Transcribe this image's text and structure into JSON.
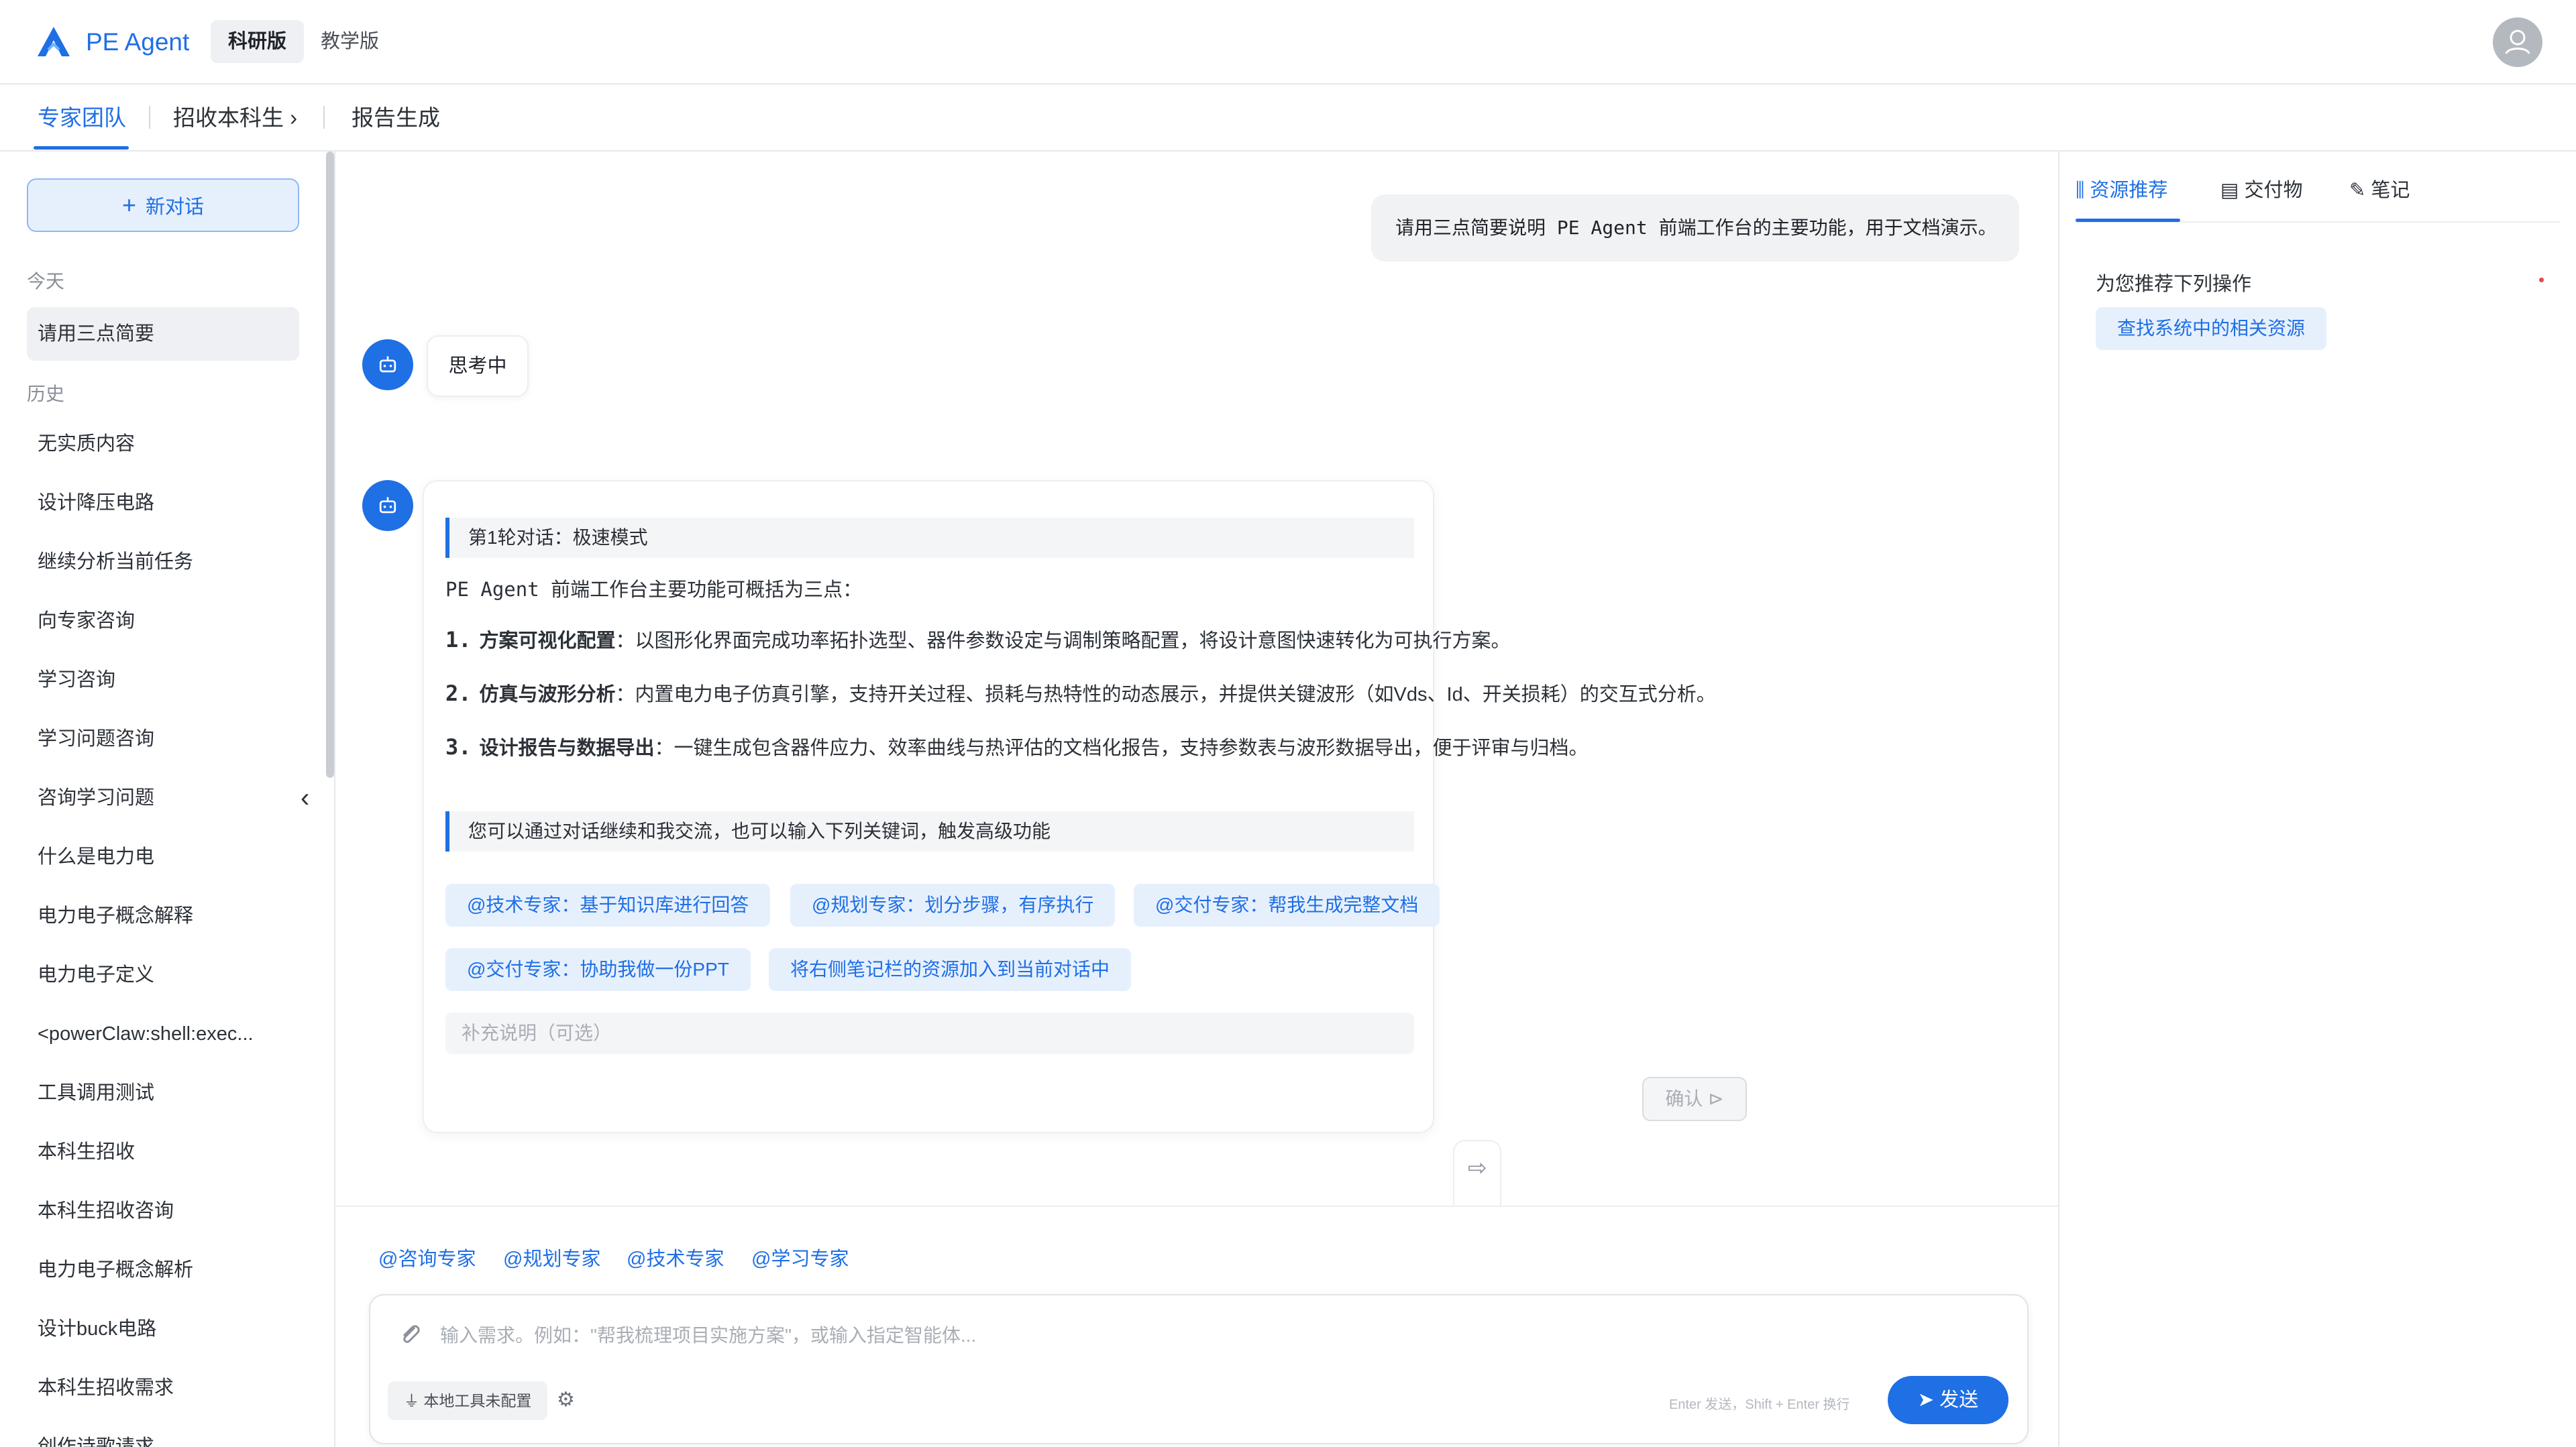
{
  "header": {
    "app_name": "PE Agent",
    "modes": [
      "科研版",
      "教学版"
    ],
    "accent_color": "#1f6fe5"
  },
  "breadcrumb": {
    "items": [
      "专家团队",
      "招收本科生 ›",
      "报告生成"
    ]
  },
  "sidebar": {
    "new_chat_label": "新对话",
    "today_label": "今天",
    "today_items": [
      "请用三点简要"
    ],
    "history_label": "历史",
    "history_items": [
      "无实质内容",
      "设计降压电路",
      "继续分析当前任务",
      "向专家咨询",
      "学习咨询",
      "学习问题咨询",
      "咨询学习问题",
      "什么是电力电",
      "电力电子概念解释",
      "电力电子定义",
      "<powerClaw:shell:exec...",
      "工具调用测试",
      "本科生招收",
      "本科生招收咨询",
      "电力电子概念解析",
      "设计buck电路",
      "本科生招收需求",
      "创作诗歌请求"
    ]
  },
  "chat": {
    "user_message": "请用三点简要说明 PE Agent 前端工作台的主要功能，用于文档演示。",
    "thinking_label": "思考中",
    "round_label": "第1轮对话：极速模式",
    "intro": "PE Agent 前端工作台主要功能可概括为三点：",
    "points": [
      {
        "num": "1.",
        "title": "方案可视化配置",
        "text": "：以图形化界面完成功率拓扑选型、器件参数设定与调制策略配置，将设计意图快速转化为可执行方案。"
      },
      {
        "num": "2.",
        "title": "仿真与波形分析",
        "text": "：内置电力电子仿真引擎，支持开关过程、损耗与热特性的动态展示，并提供关键波形（如Vds、Id、开关损耗）的交互式分析。"
      },
      {
        "num": "3.",
        "title": "设计报告与数据导出",
        "text": "：一键生成包含器件应力、效率曲线与热评估的文档化报告，支持参数表与波形数据导出，便于评审与归档。"
      }
    ],
    "followup_note": "您可以通过对话继续和我交流，也可以输入下列关键词，触发高级功能",
    "chips_row1": [
      "@技术专家：基于知识库进行回答",
      "@规划专家：划分步骤，有序执行",
      "@交付专家：帮我生成完整文档"
    ],
    "chips_row2": [
      "@交付专家：协助我做一份PPT",
      "将右侧笔记栏的资源加入到当前对话中"
    ],
    "supplement_placeholder": "补充说明（可选）",
    "confirm_label": "确认 ⊳"
  },
  "composer": {
    "mentions": [
      "@咨询专家",
      "@规划专家",
      "@技术专家",
      "@学习专家"
    ],
    "placeholder": "输入需求。例如：\"帮我梳理项目实施方案\"，或输入指定智能体...",
    "tool_label": "本地工具未配置",
    "hint": "Enter 发送，Shift + Enter 换行",
    "send_label": "发送"
  },
  "right_panel": {
    "tabs": [
      "资源推荐",
      "交付物",
      "笔记"
    ],
    "rec_title": "为您推荐下列操作",
    "rec_dot": "•",
    "rec_action": "查找系统中的相关资源"
  }
}
